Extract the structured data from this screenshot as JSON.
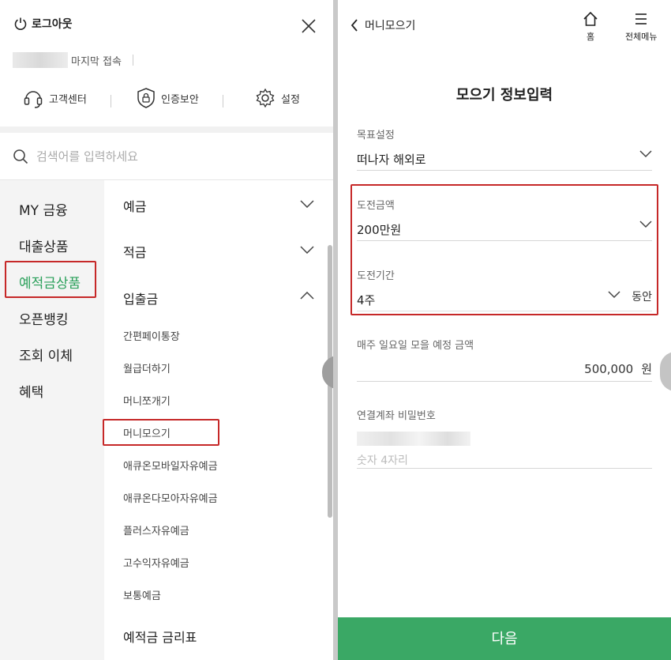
{
  "left_menu": {
    "logout_label": "로그아웃",
    "last_login_label": "마지막 접속",
    "quick_links": [
      "고객센터",
      "인증보안",
      "설정"
    ],
    "search_placeholder": "검색어를 입력하세요",
    "categories": [
      "MY 금융",
      "대출상품",
      "예적금상품",
      "오픈뱅킹",
      "조회 이체",
      "혜택"
    ],
    "active_category": "예적금상품",
    "groups": [
      "예금",
      "적금",
      "입출금"
    ],
    "sub_items": [
      "간편페이통장",
      "월급더하기",
      "머니쪼개기",
      "머니모으기",
      "애큐온모바일자유예금",
      "애큐온다모아자유예금",
      "플러스자유예금",
      "고수익자유예금",
      "보통예금"
    ],
    "rate_table_label": "예적금 금리표"
  },
  "right_form": {
    "back_label": "머니모으기",
    "home_label": "홈",
    "menu_label": "전체메뉴",
    "page_title": "모으기 정보입력",
    "goal_label": "목표설정",
    "goal_value": "떠나자 해외로",
    "amount_label": "도전금액",
    "amount_value": "200만원",
    "period_label": "도전기간",
    "period_value": "4주",
    "period_suffix": "동안",
    "weekly_label": "매주 일요일 모을 예정 금액",
    "weekly_value": "500,000",
    "weekly_unit": "원",
    "password_label": "연결계좌 비밀번호",
    "password_placeholder": "숫자 4자리",
    "next_button": "다음"
  },
  "colors": {
    "accent": "#3aa865",
    "active_text": "#2aa05a",
    "highlight": "#c62828"
  }
}
